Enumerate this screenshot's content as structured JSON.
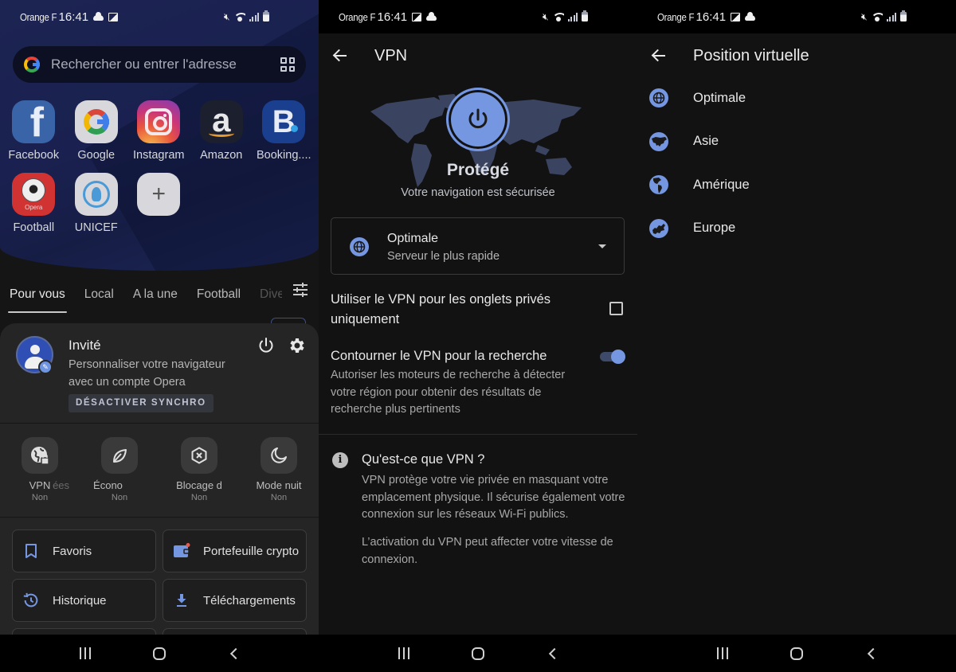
{
  "status_bar": {
    "carrier": "Orange F",
    "time": "16:41"
  },
  "screen1": {
    "search": {
      "placeholder": "Rechercher ou entrer l'adresse"
    },
    "speed_dials": [
      {
        "label": "Facebook",
        "icon": "facebook-icon"
      },
      {
        "label": "Google",
        "icon": "google-icon"
      },
      {
        "label": "Instagram",
        "icon": "instagram-icon"
      },
      {
        "label": "Amazon",
        "icon": "amazon-icon"
      },
      {
        "label": "Booking....",
        "icon": "booking-icon"
      },
      {
        "label": "Football",
        "icon": "football-icon",
        "sublabel": "Opera"
      },
      {
        "label": "UNICEF",
        "icon": "unicef-icon"
      },
      {
        "label": "",
        "icon": "add-icon"
      }
    ],
    "feed_tabs": [
      "Pour vous",
      "Local",
      "A la une",
      "Football",
      "Dive"
    ],
    "active_feed_tab": "Pour vous",
    "profile": {
      "name": "Invité",
      "description": "Personnaliser votre navigateur avec un compte Opera",
      "sync_button": "DÉSACTIVER SYNCHRO"
    },
    "quick_actions": [
      {
        "label": "VPN",
        "status": "Non",
        "icon": "vpn-globe-lock-icon"
      },
      {
        "label": "ées",
        "label2": "Écono",
        "status": "Non",
        "icon": "leaf-icon"
      },
      {
        "label": "Blocage d",
        "status": "Non",
        "icon": "ad-block-icon"
      },
      {
        "label": "Mode nuit",
        "status": "Non",
        "icon": "moon-icon"
      }
    ],
    "tiles": [
      {
        "label": "Favoris",
        "icon": "bookmark-icon"
      },
      {
        "label": "Portefeuille crypto",
        "icon": "wallet-icon",
        "badge": true
      },
      {
        "label": "Historique",
        "icon": "history-icon"
      },
      {
        "label": "Téléchargements",
        "icon": "download-icon"
      }
    ]
  },
  "screen2": {
    "title": "VPN",
    "status": "Protégé",
    "status_sub": "Votre navigation est sécurisée",
    "vpn_enabled": true,
    "location": {
      "title": "Optimale",
      "subtitle": "Serveur le plus rapide"
    },
    "settings": [
      {
        "title": "Utiliser le VPN pour les onglets privés uniquement",
        "type": "checkbox",
        "checked": false
      },
      {
        "title": "Contourner le VPN pour la recherche",
        "description": "Autoriser les moteurs de recherche à détecter votre région pour obtenir des résultats de recherche plus pertinents",
        "type": "toggle",
        "checked": true
      }
    ],
    "info": {
      "title": "Qu'est-ce que VPN ?",
      "body": "VPN protège votre vie privée en masquant votre emplacement physique. Il sécurise également votre connexion sur les réseaux Wi-Fi publics.",
      "body2": "L’activation du VPN peut affecter votre vitesse de connexion."
    }
  },
  "screen3": {
    "title": "Position virtuelle",
    "regions": [
      {
        "label": "Optimale",
        "icon": "globe-icon"
      },
      {
        "label": "Asie",
        "icon": "asia-map-icon"
      },
      {
        "label": "Amérique",
        "icon": "america-map-icon"
      },
      {
        "label": "Europe",
        "icon": "europe-map-icon"
      }
    ]
  },
  "colors": {
    "accent": "#7596e0",
    "hero_bg": "#1c2452",
    "sheet_bg": "#252525",
    "screen_bg": "#121212",
    "badge_red": "#e55a4e"
  }
}
